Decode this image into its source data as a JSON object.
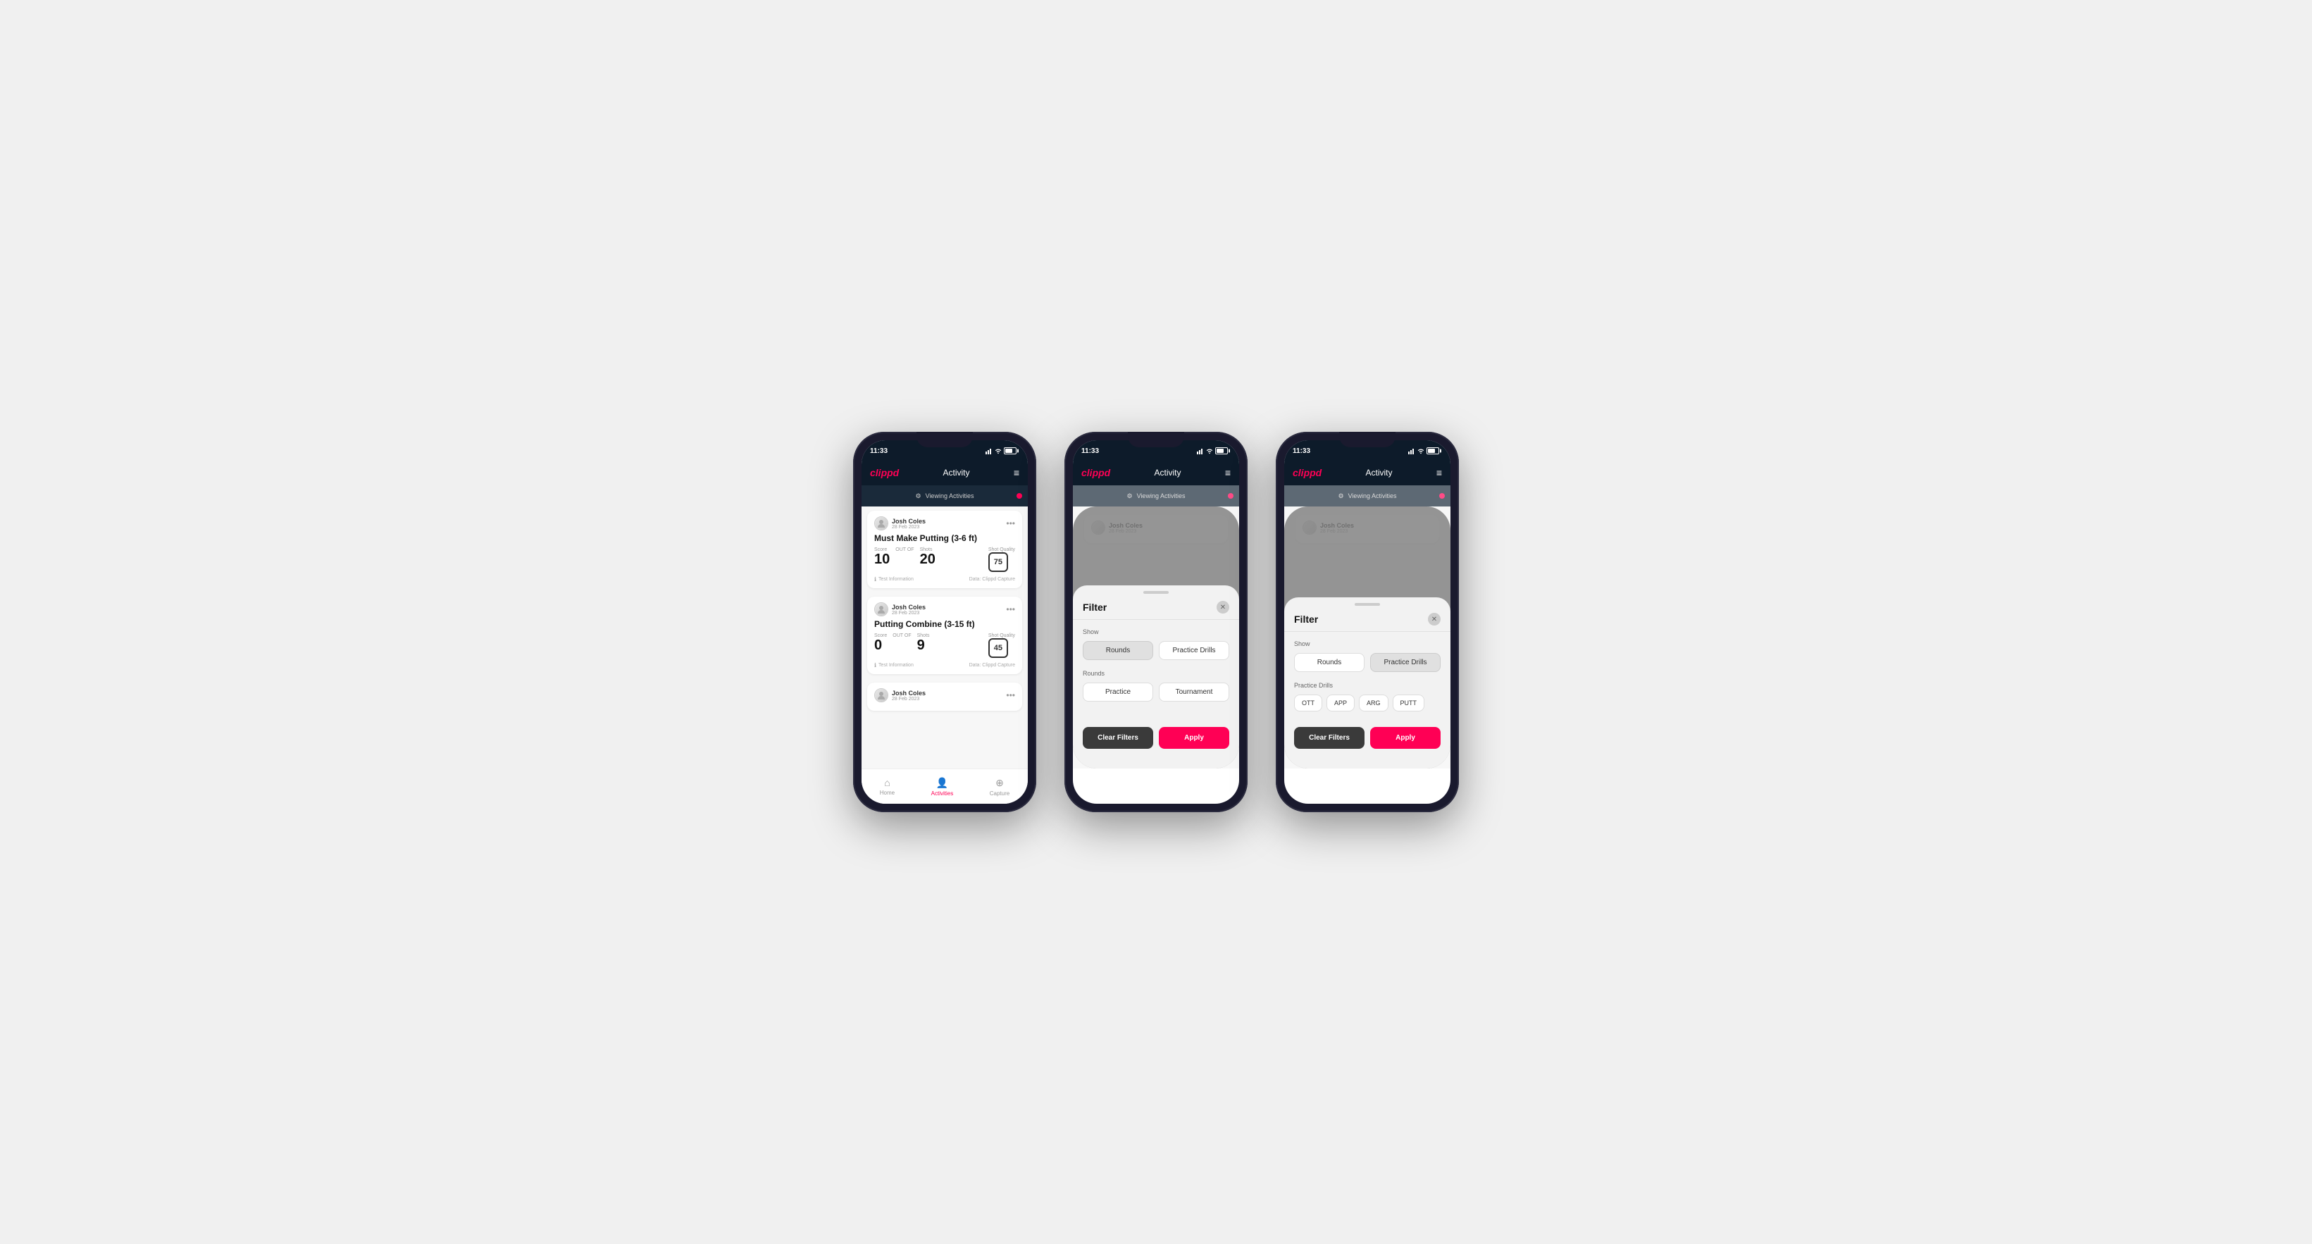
{
  "app": {
    "logo": "clippd",
    "title": "Activity",
    "time": "11:33"
  },
  "viewing_bar": {
    "text": "Viewing Activities",
    "icon": "⚙"
  },
  "user": {
    "name": "Josh Coles",
    "date": "28 Feb 2023"
  },
  "cards": [
    {
      "title": "Must Make Putting (3-6 ft)",
      "score_label": "Score",
      "score_value": "10",
      "shots_label": "Shots",
      "shots_value": "20",
      "shot_quality_label": "Shot Quality",
      "shot_quality_value": "75",
      "footer_left": "Test Information",
      "footer_right": "Data: Clippd Capture"
    },
    {
      "title": "Putting Combine (3-15 ft)",
      "score_label": "Score",
      "score_value": "0",
      "shots_label": "Shots",
      "shots_value": "9",
      "shot_quality_label": "Shot Quality",
      "shot_quality_value": "45",
      "footer_left": "Test Information",
      "footer_right": "Data: Clippd Capture"
    }
  ],
  "bottom_nav": {
    "home": "Home",
    "activities": "Activities",
    "capture": "Capture"
  },
  "filter": {
    "title": "Filter",
    "show_label": "Show",
    "rounds_btn": "Rounds",
    "practice_drills_btn": "Practice Drills",
    "rounds_label": "Rounds",
    "practice_label": "Practice",
    "tournament_label": "Tournament",
    "practice_drills_section": "Practice Drills",
    "drill_buttons": [
      "OTT",
      "APP",
      "ARG",
      "PUTT"
    ],
    "clear_btn": "Clear Filters",
    "apply_btn": "Apply"
  }
}
